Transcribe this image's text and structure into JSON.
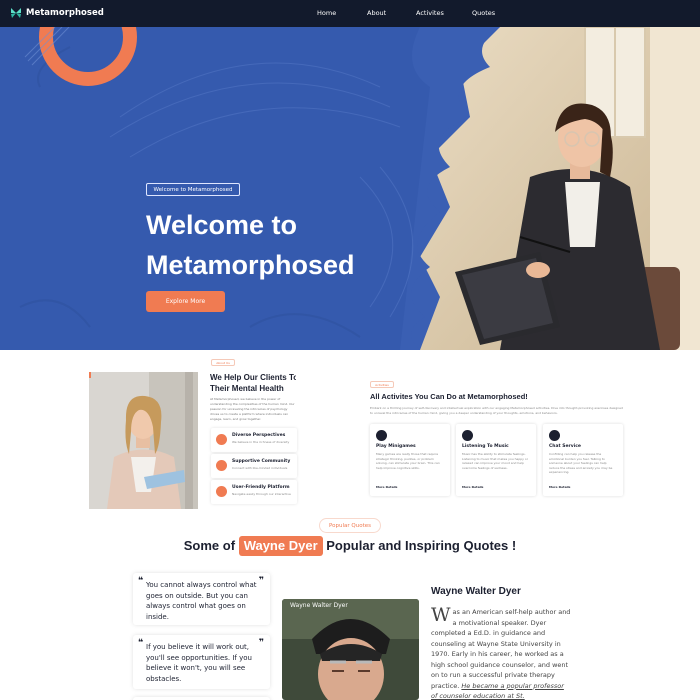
{
  "nav": {
    "brand": "Metamorphosed",
    "links": [
      "Home",
      "About",
      "Activites",
      "Quotes"
    ]
  },
  "hero": {
    "badge": "Welcome to Metamorphosed",
    "title_line1": "Welcome to",
    "title_line2": "Metamorphosed",
    "button": "Explore More"
  },
  "about": {
    "small_label": "About Us",
    "title_line1": "We Help Our Clients To G",
    "title_line2": "Their Mental Health",
    "description": "At Metamorphosed, we believe in the power of understanding the complexities of the human mind. Our passion for unraveling the intricacies of psychology drives us to create a platform where individuals can engage, learn, and grow together.",
    "features": [
      {
        "title": "Diverse Perspectives",
        "desc": "We believe in the richness of diversity"
      },
      {
        "title": "Supportive Community",
        "desc": "Connect with like-minded individuals"
      },
      {
        "title": "User-Friendly Platform",
        "desc": "Navigate easily through our interactive"
      }
    ]
  },
  "activities": {
    "small_label": "Activities",
    "title": "All Activites You Can Do at Metamorphosed!",
    "description": "Embark on a thrilling journey of self-discovery and intellectual exploration with our engaging Metamorphosed activities. Dive into thought-provoking exercises designed to unravel the intricacies of the human mind, giving you a deeper understanding of your thoughts, emotions, and behaviors.",
    "cards": [
      {
        "title": "Play Minigames",
        "desc": "Many games are really those that require strategic thinking, puzzles, or problem solving, can stimulate your brain. This can help improve cognitive skills.",
        "link": "More Details"
      },
      {
        "title": "Listening To Music",
        "desc": "Music has the ability to stimulate feelings. Listening to music that makes you happy or relaxed can improve your mood and help overcome feelings of sadness.",
        "link": "More Details"
      },
      {
        "title": "Chat Service",
        "desc": "Confiding can help you release the emotional burden you feel. Talking to someone about your feelings can help reduce the stress and anxiety you may be experiencing.",
        "link": "More Details"
      }
    ]
  },
  "quotes": {
    "pill": "Popular Quotes",
    "title_pre": "Some of",
    "title_name": "Wayne Dyer",
    "title_post": "Popular and Inspiring Quotes !",
    "items": [
      "You cannot always control what goes on outside. But you can always control what goes on inside.",
      "If you believe it will work out, you'll see opportunities. If you believe it won't, you will see obstacles."
    ],
    "photo_label": "Wayne Walter Dyer",
    "bio_name": "Wayne Walter Dyer",
    "bio_initial": "W",
    "bio_text": "as an American self-help author and a motivational speaker. Dyer completed a Ed.D. in guidance and counseling at Wayne State University in 1970. Early in his career, he worked as a high school guidance counselor, and went on to run a successful private therapy practice. ",
    "bio_link": "He became a popular professor of counselor education at St."
  },
  "colors": {
    "accent": "#f07b52",
    "nav_bg": "#121a2c",
    "hero_blue": "#3a5fb3",
    "text_dark": "#1c2030"
  }
}
